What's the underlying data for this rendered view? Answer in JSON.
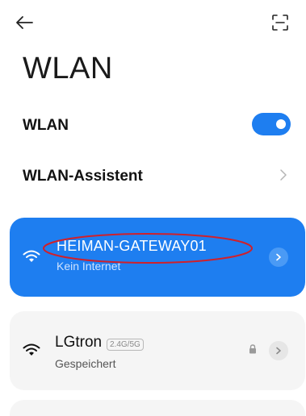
{
  "header": {
    "back_icon": "arrow-left-icon",
    "scan_icon": "qr-scan-icon"
  },
  "page": {
    "title": "WLAN"
  },
  "settings": {
    "wlan_label": "WLAN",
    "wlan_enabled": true,
    "assistant_label": "WLAN-Assistent"
  },
  "connected_network": {
    "name": "HEIMAN-GATEWAY01",
    "status": "Kein Internet",
    "icon": "wifi-icon"
  },
  "saved_network": {
    "name": "LGtron",
    "band": "2.4G/5G",
    "status": "Gespeichert",
    "secured": true,
    "icon": "wifi-icon"
  },
  "colors": {
    "accent": "#1e7ef0",
    "annotation": "#d0202a",
    "card_bg": "#f5f5f5"
  }
}
